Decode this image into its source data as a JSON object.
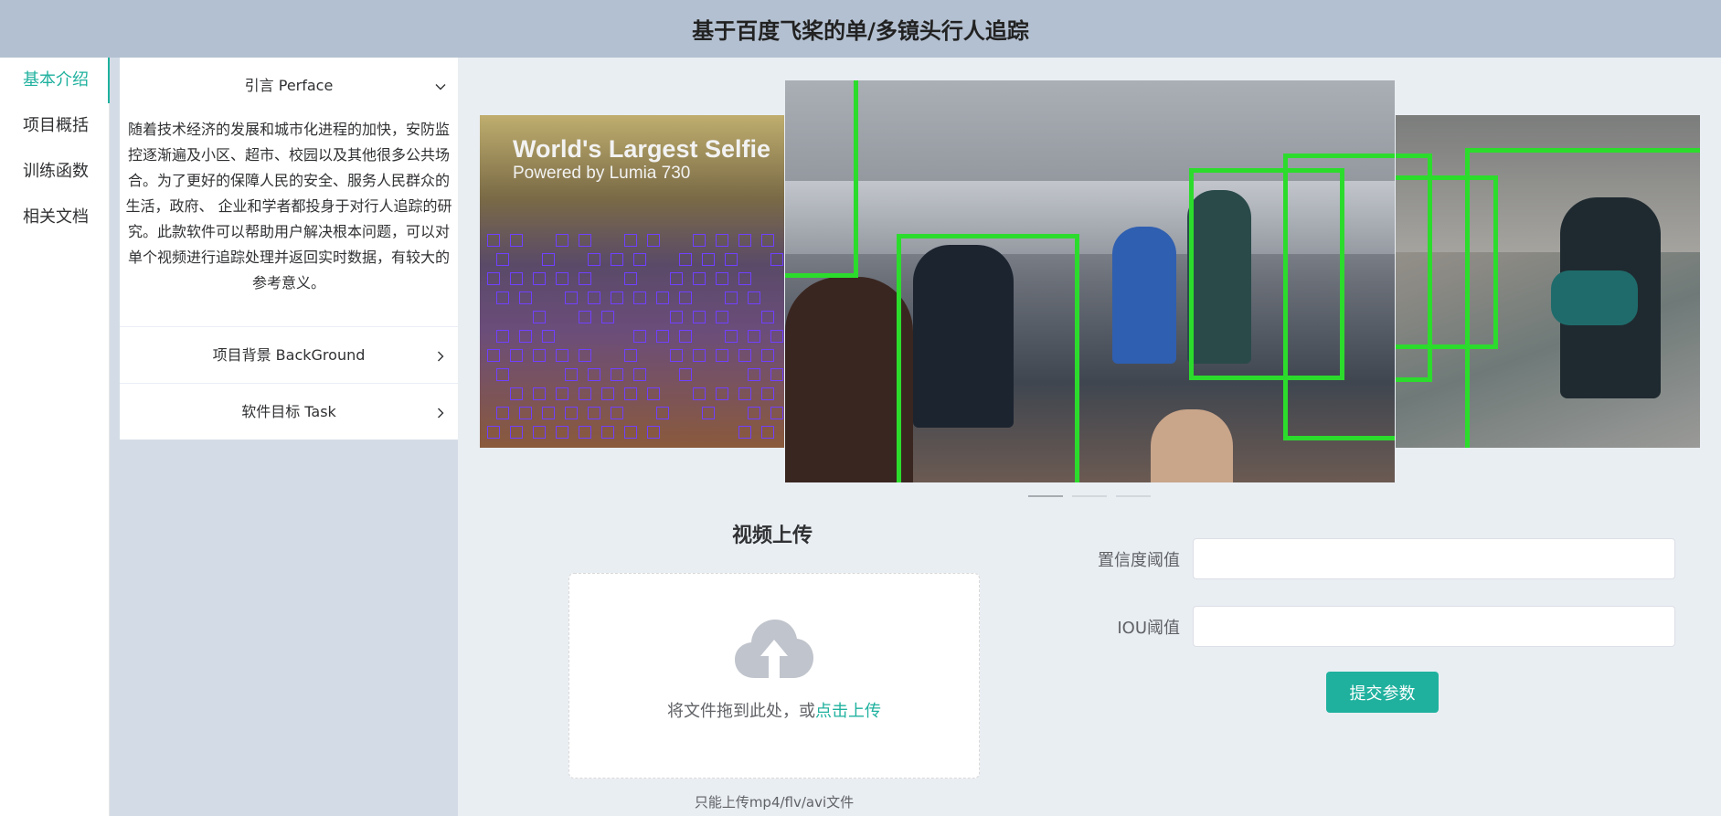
{
  "header": {
    "title": "基于百度飞桨的单/多镜头行人追踪"
  },
  "nav": {
    "items": [
      {
        "label": "基本介绍",
        "active": true
      },
      {
        "label": "项目概括",
        "active": false
      },
      {
        "label": "训练函数",
        "active": false
      },
      {
        "label": "相关文档",
        "active": false
      }
    ]
  },
  "collapse": {
    "items": [
      {
        "title": "引言 Perface",
        "expanded": true,
        "content": "随着技术经济的发展和城市化进程的加快，安防监控逐渐遍及小区、超市、校园以及其他很多公共场合。为了更好的保障人民的安全、服务人民群众的生活，政府、 企业和学者都投身于对行人追踪的研究。此款软件可以帮助用户解决根本问题，可以对单个视频进行追踪处理并返回实时数据，有较大的参考意义。"
      },
      {
        "title": "项目背景 BackGround",
        "expanded": false
      },
      {
        "title": "软件目标 Task",
        "expanded": false
      }
    ]
  },
  "carousel": {
    "left_caption_line1": "World's Largest Selfie",
    "left_caption_line2": "Powered by Lumia 730",
    "indicator_count": 3,
    "active_index": 1
  },
  "upload": {
    "title": "视频上传",
    "drag_text": "将文件拖到此处，或",
    "click_text": "点击上传",
    "tip": "只能上传mp4/flv/avi文件"
  },
  "form": {
    "confidence_label": "置信度阈值",
    "confidence_value": "",
    "iou_label": "IOU阈值",
    "iou_value": "",
    "submit_label": "提交参数"
  },
  "colors": {
    "accent": "#1fb19e",
    "header_bg": "#b3c0d1",
    "aside_bg": "#d3dce6",
    "main_bg": "#e9eef3",
    "detect_box": "#2cdc2c"
  }
}
